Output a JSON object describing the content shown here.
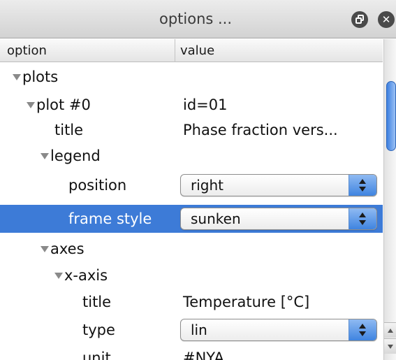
{
  "window": {
    "title": "options ..."
  },
  "header": {
    "option": "option",
    "value": "value"
  },
  "rows": [
    {
      "name": "plots",
      "value": "",
      "expanded": true,
      "kind": "group"
    },
    {
      "name": "plot #0",
      "value": "id=01",
      "expanded": true,
      "kind": "group"
    },
    {
      "name": "title",
      "value": "Phase fraction vers...",
      "kind": "text"
    },
    {
      "name": "legend",
      "value": "",
      "expanded": true,
      "kind": "group"
    },
    {
      "name": "position",
      "value": "right",
      "kind": "select"
    },
    {
      "name": "frame style",
      "value": "sunken",
      "kind": "select",
      "selected": true
    },
    {
      "name": "axes",
      "value": "",
      "expanded": true,
      "kind": "group"
    },
    {
      "name": "x-axis",
      "value": "",
      "expanded": true,
      "kind": "group"
    },
    {
      "name": "title",
      "value": "Temperature [°C]",
      "kind": "text"
    },
    {
      "name": "type",
      "value": "lin",
      "kind": "select"
    },
    {
      "name": "unit",
      "value": "#NYA",
      "kind": "text"
    }
  ],
  "colors": {
    "selection": "#3d7bd7",
    "select_arrows": "#3f84e0",
    "scroll_thumb": "#3c7fe0"
  },
  "icons": {
    "restore": "restore-window-icon",
    "close": "close-icon",
    "disclosure": "disclosure-triangle-icon",
    "select_arrows": "up-down-arrows-icon"
  }
}
